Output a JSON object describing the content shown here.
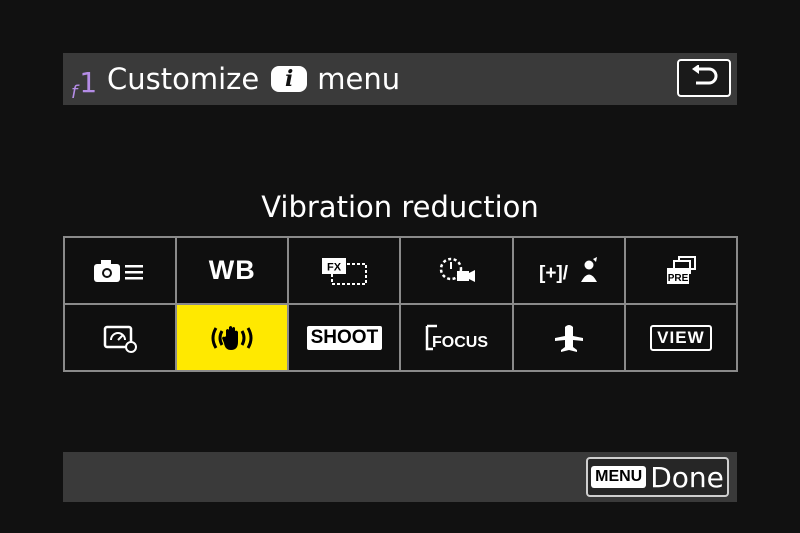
{
  "header": {
    "menu_code_letter": "f",
    "menu_code_number": "1",
    "title_prefix": "Customize",
    "title_badge": "i",
    "title_suffix": "menu"
  },
  "selected_item_label": "Vibration reduction",
  "grid": {
    "row1": [
      {
        "icon": "camera-menu-icon"
      },
      {
        "text": "WB"
      },
      {
        "icon": "fx-format-icon",
        "text": "FX"
      },
      {
        "icon": "movie-timer-icon"
      },
      {
        "icon": "exposure-comp-icon",
        "text": "[+]/"
      },
      {
        "icon": "pre-release-capture-icon",
        "text": "PRE"
      }
    ],
    "row2": [
      {
        "icon": "monitor-brightness-icon"
      },
      {
        "icon": "vibration-reduction-icon",
        "selected": true
      },
      {
        "text": "SHOOT"
      },
      {
        "icon": "focus-icon",
        "text": "FOCUS"
      },
      {
        "icon": "airplane-mode-icon"
      },
      {
        "text": "VIEW"
      }
    ]
  },
  "footer": {
    "menu_tag": "MENU",
    "done_label": "Done"
  },
  "colors": {
    "background": "#111111",
    "bar": "#3a3a3a",
    "highlight": "#ffe900",
    "menu_code": "#b48ce6"
  }
}
